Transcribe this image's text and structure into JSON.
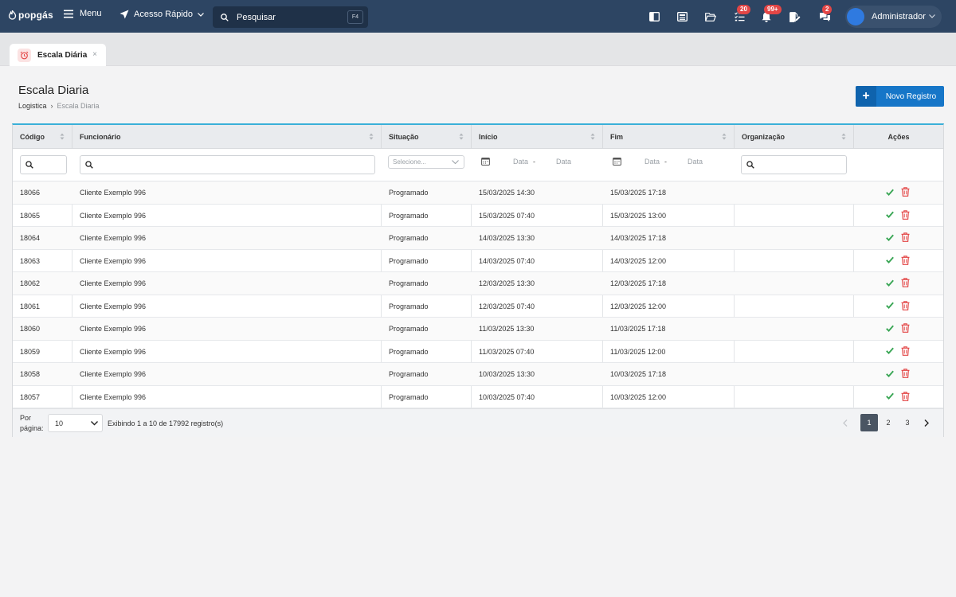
{
  "app": {
    "logo": "popgás",
    "menu_label": "Menu",
    "quick_access_label": "Acesso Rápido",
    "search_placeholder": "Pesquisar",
    "search_shortcut": "F4",
    "badges": {
      "tasks": "20",
      "notifications": "99+",
      "messages": "2"
    },
    "user_name": "Administrador"
  },
  "tab": {
    "label": "Escala Diária",
    "close": "×"
  },
  "page": {
    "title": "Escala Diaria",
    "breadcrumb": [
      "Logistica",
      "Escala Diaria"
    ],
    "breadcrumb_sep": "›",
    "new_button": "Novo Registro",
    "new_button_plus": "+"
  },
  "table": {
    "columns": [
      "Código",
      "Funcionário",
      "Situação",
      "Início",
      "Fim",
      "Organização",
      "Ações"
    ],
    "filters": {
      "situacao_placeholder": "Selecione...",
      "date_from": "Data",
      "date_sep": "-",
      "date_to": "Data"
    },
    "rows": [
      [
        "18066",
        "Cliente Exemplo 996",
        "Programado",
        "15/03/2025 14:30",
        "15/03/2025 17:18",
        ""
      ],
      [
        "18065",
        "Cliente Exemplo 996",
        "Programado",
        "15/03/2025 07:40",
        "15/03/2025 13:00",
        ""
      ],
      [
        "18064",
        "Cliente Exemplo 996",
        "Programado",
        "14/03/2025 13:30",
        "14/03/2025 17:18",
        ""
      ],
      [
        "18063",
        "Cliente Exemplo 996",
        "Programado",
        "14/03/2025 07:40",
        "14/03/2025 12:00",
        ""
      ],
      [
        "18062",
        "Cliente Exemplo 996",
        "Programado",
        "12/03/2025 13:30",
        "12/03/2025 17:18",
        ""
      ],
      [
        "18061",
        "Cliente Exemplo 996",
        "Programado",
        "12/03/2025 07:40",
        "12/03/2025 12:00",
        ""
      ],
      [
        "18060",
        "Cliente Exemplo 996",
        "Programado",
        "11/03/2025 13:30",
        "11/03/2025 17:18",
        ""
      ],
      [
        "18059",
        "Cliente Exemplo 996",
        "Programado",
        "11/03/2025 07:40",
        "11/03/2025 12:00",
        ""
      ],
      [
        "18058",
        "Cliente Exemplo 996",
        "Programado",
        "10/03/2025 13:30",
        "10/03/2025 17:18",
        ""
      ],
      [
        "18057",
        "Cliente Exemplo 996",
        "Programado",
        "10/03/2025 07:40",
        "10/03/2025 12:00",
        ""
      ]
    ],
    "footer": {
      "per_page_label": "Por página:",
      "per_page_value": "10",
      "showing": "Exibindo 1 a 10 de 17992 registro(s)",
      "pages": [
        "1",
        "2",
        "3"
      ],
      "current_page": "1"
    }
  },
  "colors": {
    "topbar": "#2d4563",
    "primary": "#1676c8",
    "accent_border": "#3ab0d8",
    "success": "#3aa655",
    "danger": "#e34646"
  }
}
